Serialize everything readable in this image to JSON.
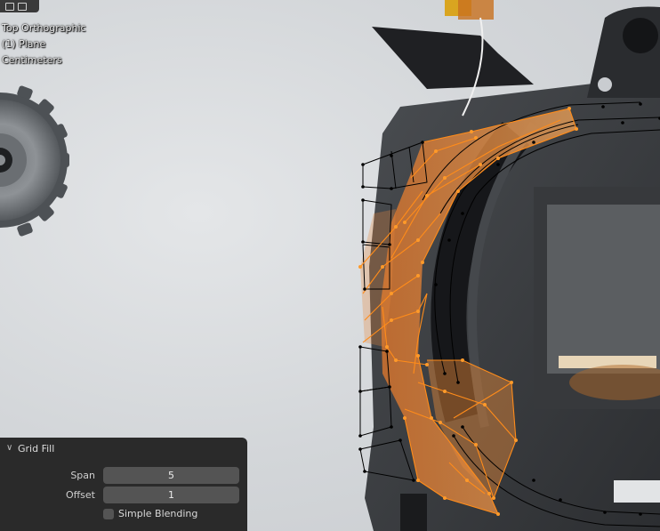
{
  "viewport": {
    "view_name": "Top Orthographic",
    "object_info": "(1) Plane",
    "units": "Centimeters"
  },
  "operator_panel": {
    "title": "Grid Fill",
    "span_label": "Span",
    "span_value": "5",
    "offset_label": "Offset",
    "offset_value": "1",
    "simple_blending_label": "Simple Blending",
    "simple_blending_checked": false
  },
  "colors": {
    "selection": "#ff8c1a",
    "wire": "#000000",
    "panel_bg": "#242424",
    "field_bg": "#545454"
  }
}
